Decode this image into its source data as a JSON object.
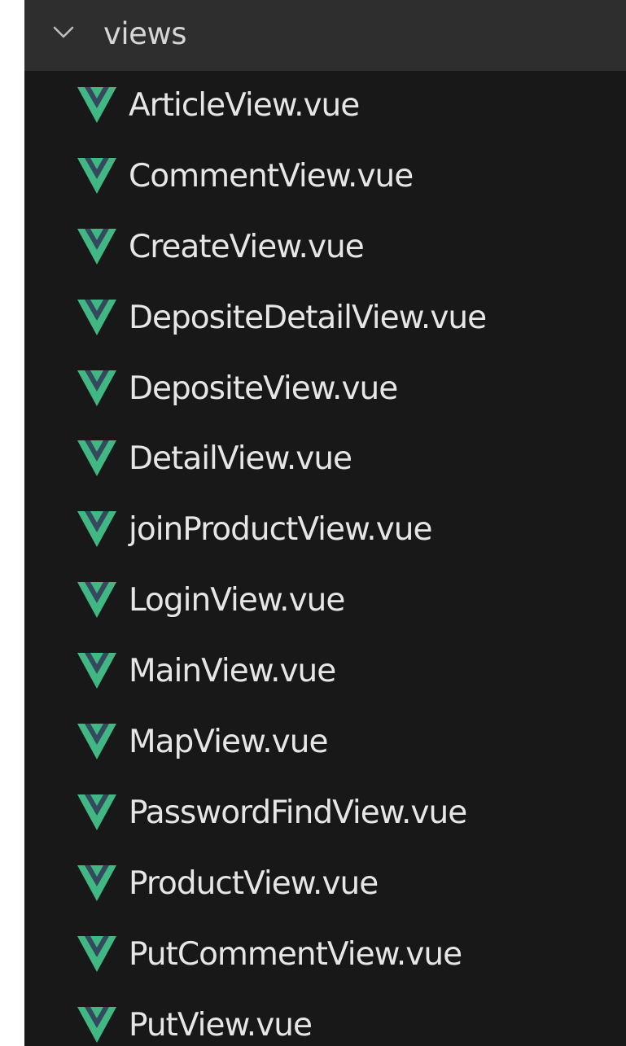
{
  "explorer": {
    "folder": {
      "label": "views",
      "icon": "chevron-down-icon",
      "expanded": true
    },
    "files": [
      {
        "label": "ArticleView.vue",
        "icon": "vue-icon"
      },
      {
        "label": "CommentView.vue",
        "icon": "vue-icon"
      },
      {
        "label": "CreateView.vue",
        "icon": "vue-icon"
      },
      {
        "label": "DepositeDetailView.vue",
        "icon": "vue-icon"
      },
      {
        "label": "DepositeView.vue",
        "icon": "vue-icon"
      },
      {
        "label": "DetailView.vue",
        "icon": "vue-icon"
      },
      {
        "label": "joinProductView.vue",
        "icon": "vue-icon"
      },
      {
        "label": "LoginView.vue",
        "icon": "vue-icon"
      },
      {
        "label": "MainView.vue",
        "icon": "vue-icon"
      },
      {
        "label": "MapView.vue",
        "icon": "vue-icon"
      },
      {
        "label": "PasswordFindView.vue",
        "icon": "vue-icon"
      },
      {
        "label": "ProductView.vue",
        "icon": "vue-icon"
      },
      {
        "label": "PutCommentView.vue",
        "icon": "vue-icon"
      },
      {
        "label": "PutView.vue",
        "icon": "vue-icon"
      }
    ]
  },
  "colors": {
    "panel_background": "#181818",
    "header_background": "#2e2e2f",
    "text": "#e6e6e6",
    "vue_green": "#41b883",
    "vue_dark": "#34495e"
  }
}
